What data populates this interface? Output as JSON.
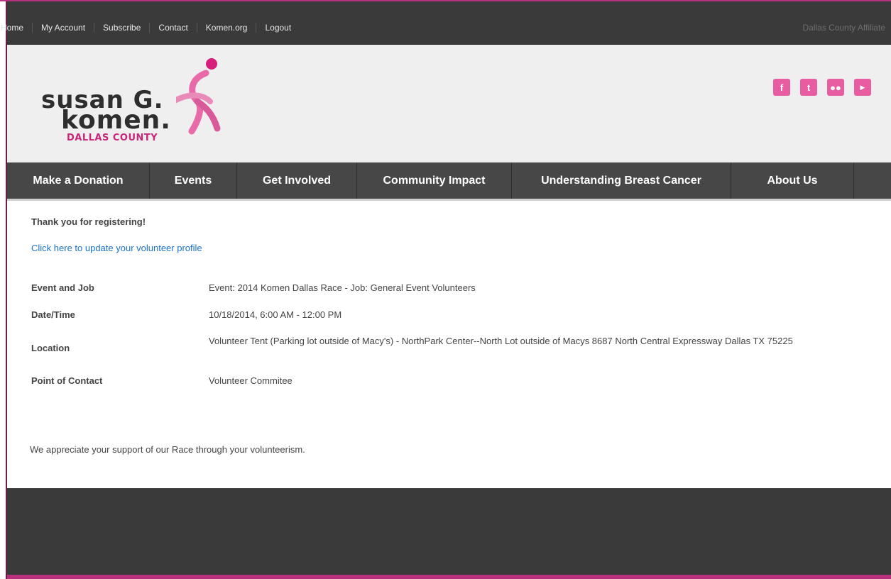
{
  "topnav": {
    "links": [
      "Home",
      "My Account",
      "Subscribe",
      "Contact",
      "Komen.org",
      "Logout"
    ],
    "affiliate": "Dallas County Affiliate"
  },
  "logo": {
    "line1": "susan G.",
    "line2": "komen.",
    "line3": "DALLAS COUNTY"
  },
  "social": [
    "facebook-icon",
    "twitter-icon",
    "flickr-icon",
    "youtube-icon"
  ],
  "mainnav": [
    "Make a Donation",
    "Events",
    "Get Involved",
    "Community Impact",
    "Understanding Breast Cancer",
    "About Us"
  ],
  "content": {
    "thanks": "Thank you for registering!",
    "update_link": "Click here to update your volunteer profile",
    "rows": [
      {
        "label": "Event and Job",
        "value": "Event: 2014 Komen Dallas Race - Job: General Event Volunteers"
      },
      {
        "label": "Date/Time",
        "value": "10/18/2014, 6:00 AM - 12:00 PM"
      },
      {
        "label": "Location",
        "value": "Volunteer Tent (Parking lot outside of Macy's) - NorthPark Center--North Lot outside of Macys 8687 North Central Expressway Dallas TX 75225"
      },
      {
        "label": "Point of Contact",
        "value": "Volunteer Commitee"
      }
    ],
    "appreciate": "We appreciate your support of our Race through your volunteerism."
  },
  "colors": {
    "accent": "#e85ca2",
    "link": "#1a73c9",
    "dark_bar": "#3a3a3a"
  }
}
